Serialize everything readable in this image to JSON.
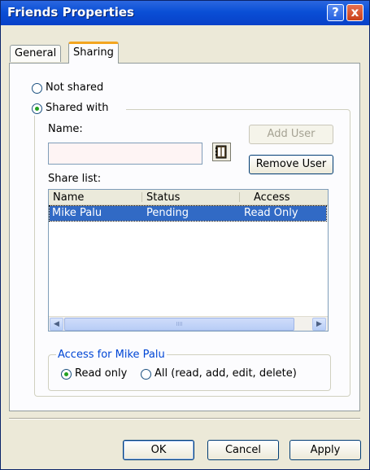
{
  "window": {
    "title": "Friends Properties",
    "help_icon": "?",
    "close_icon": "x"
  },
  "tabs": [
    {
      "label": "General"
    },
    {
      "label": "Sharing"
    }
  ],
  "sharing": {
    "not_shared_label": "Not shared",
    "shared_with_label": "Shared with",
    "name_label": "Name:",
    "name_value": "",
    "add_user_label": "Add User",
    "remove_user_label": "Remove User",
    "share_list_label": "Share list:",
    "columns": [
      "Name",
      "Status",
      "Access"
    ],
    "rows": [
      {
        "name": "Mike Palu",
        "status": "Pending",
        "access": "Read Only"
      }
    ],
    "scroll_grip": "IIII",
    "access_group_label": "Access for Mike Palu",
    "read_only_label": "Read only",
    "all_access_label": "All (read, add, edit, delete)",
    "selected_mode": "Shared with",
    "selected_access": "Read only"
  },
  "footer": {
    "ok_label": "OK",
    "cancel_label": "Cancel",
    "apply_label": "Apply"
  },
  "colors": {
    "title_bar": "#0a4fd6",
    "tab_accent": "#f3a520",
    "selection": "#316ac5",
    "radio_dot": "#21a121"
  }
}
